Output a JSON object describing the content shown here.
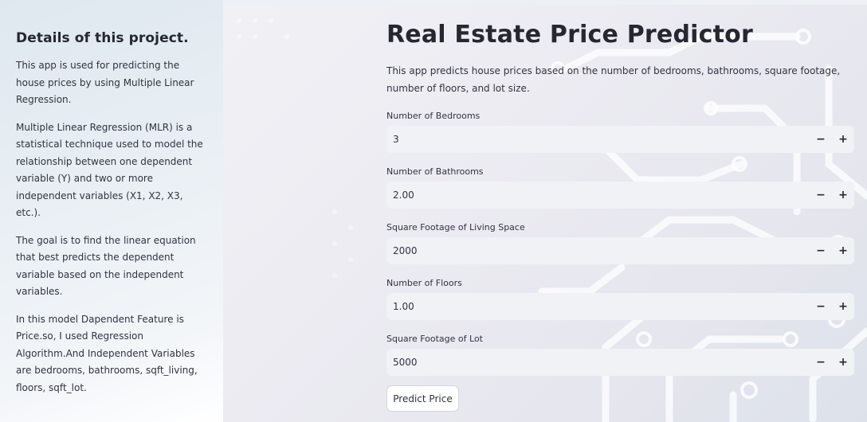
{
  "sidebar": {
    "heading": "Details of this project.",
    "paragraphs": [
      "This app is used for predicting the house prices by using Multiple Linear Regression.",
      "Multiple Linear Regression (MLR) is a statistical technique used to model the relationship between one dependent variable (Y) and two or more independent variables (X1, X2, X3, etc.).",
      "The goal is to find the linear equation that best predicts the dependent variable based on the independent variables.",
      "In this model Dapendent Feature is Price.so, I used Regression Algorithm.And Independent Variables are bedrooms, bathrooms, sqft_living, floors, sqft_lot."
    ]
  },
  "main": {
    "title": "Real Estate Price Predictor",
    "description": "This app predicts house prices based on the number of bedrooms, bathrooms, square footage, number of floors, and lot size.",
    "fields": [
      {
        "label": "Number of Bedrooms",
        "value": "3",
        "minus": "−",
        "plus": "+"
      },
      {
        "label": "Number of Bathrooms",
        "value": "2.00",
        "minus": "−",
        "plus": "+"
      },
      {
        "label": "Square Footage of Living Space",
        "value": "2000",
        "minus": "−",
        "plus": "+"
      },
      {
        "label": "Number of Floors",
        "value": "1.00",
        "minus": "−",
        "plus": "+"
      },
      {
        "label": "Square Footage of Lot",
        "value": "5000",
        "minus": "−",
        "plus": "+"
      }
    ],
    "predict_button": "Predict Price"
  }
}
